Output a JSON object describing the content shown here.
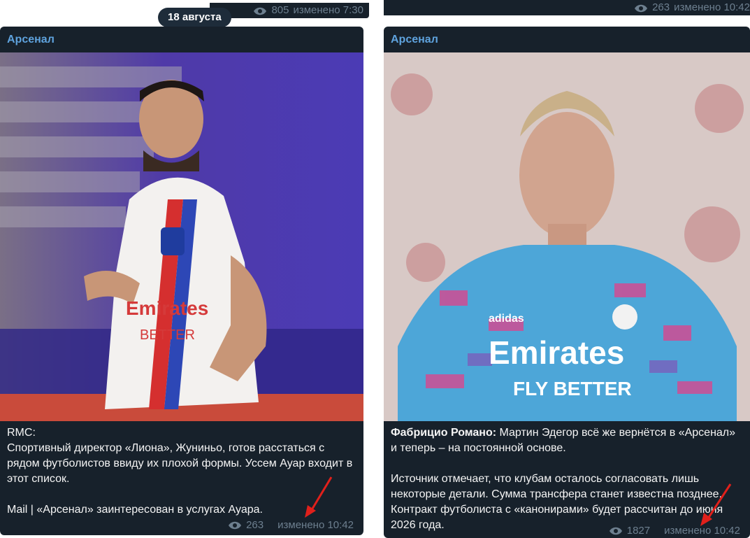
{
  "date_separator": "18 августа",
  "prev_left": {
    "views": "805",
    "status": "изменено 7:30"
  },
  "prev_right": {
    "views": "263",
    "status": "изменено 10:42"
  },
  "left_post": {
    "channel": "Арсенал",
    "photo_description": "Player in white Lyon jersey with red and blue stripes, Emirates Fly Better, looking up",
    "source": "RMC:",
    "body": "Спортивный директор «Лиона», Жуниньо, готов расстаться с рядом футболистов ввиду их плохой формы. Уссем Ауар входит в этот список.",
    "link_line": "Mail | «Арсенал» заинтересован в услугах Ауара.",
    "views": "263",
    "status": "изменено 10:42"
  },
  "right_post": {
    "channel": "Арсенал",
    "photo_description": "Player in blue and pink camouflage Real Madrid training shirt with Emirates Fly Better",
    "author": "Фабрицио Романо:",
    "body_1": " Мартин Эдегор всё же вернётся в «Арсенал» и теперь – на постоянной основе.",
    "body_2": "Источник отмечает, что клубам осталось согласовать лишь некоторые детали. Сумма трансфера станет известна позднее. Контракт футболиста с «канонирами» будет рассчитан до июня 2026 года.",
    "views": "1827",
    "status": "изменено 10:42"
  },
  "colors": {
    "background": "#17212b",
    "channel": "#5fa3de",
    "meta": "#6d7f8f",
    "arrow": "#e0201b"
  },
  "icons": {
    "views": "eye-icon",
    "annotation": "red-arrow"
  }
}
